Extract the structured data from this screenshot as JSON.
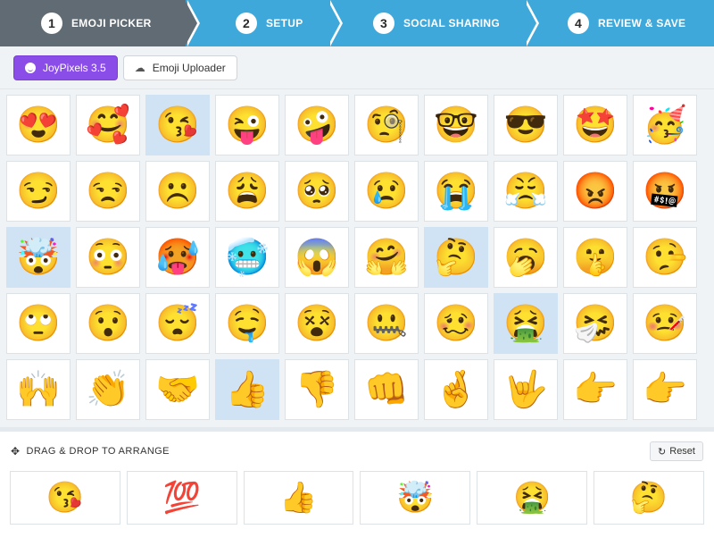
{
  "stepper": {
    "steps": [
      {
        "number": "1",
        "label": "EMOJI PICKER"
      },
      {
        "number": "2",
        "label": "SETUP"
      },
      {
        "number": "3",
        "label": "SOCIAL SHARING"
      },
      {
        "number": "4",
        "label": "REVIEW & SAVE"
      }
    ],
    "active_color": "#606b73",
    "inactive_color": "#3ea8db"
  },
  "toolbar": {
    "sources": [
      {
        "label": "JoyPixels 3.5",
        "icon": "smiley-icon",
        "active": true
      },
      {
        "label": "Emoji Uploader",
        "icon": "cloud-upload-icon",
        "active": false
      }
    ],
    "accent_color": "#8a4de8"
  },
  "emoji_grid": {
    "rows": [
      [
        "😍",
        "🥰",
        "😘",
        "😜",
        "🤪",
        "🧐",
        "🤓",
        "😎",
        "🤩",
        "🥳"
      ],
      [
        "😏",
        "😒",
        "☹️",
        "😩",
        "🥺",
        "😢",
        "😭",
        "😤",
        "😡",
        "🤬"
      ],
      [
        "🤯",
        "😳",
        "🥵",
        "🥶",
        "😱",
        "🤗",
        "🤔",
        "🥱",
        "🤫",
        "🤥"
      ],
      [
        "🙄",
        "😯",
        "😴",
        "🤤",
        "😵",
        "🤐",
        "🥴",
        "🤮",
        "🤧",
        "🤒"
      ],
      [
        "🙌",
        "👏",
        "🤝",
        "👍",
        "👎",
        "👊",
        "🤞",
        "🤟",
        "👉",
        "👉"
      ]
    ],
    "selected": [
      "0-2",
      "2-0",
      "2-6",
      "3-7",
      "4-3"
    ]
  },
  "arrange": {
    "title": "DRAG & DROP TO ARRANGE",
    "reset_label": "Reset",
    "slots": [
      "😘",
      "💯",
      "👍",
      "🤯",
      "🤮",
      "🤔"
    ]
  }
}
